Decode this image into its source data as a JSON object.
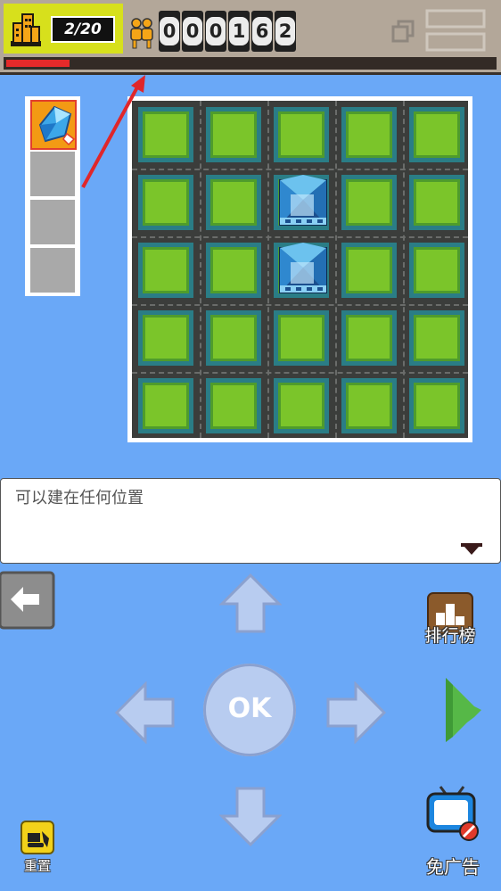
{
  "hud": {
    "buildings_count": "2/20",
    "score_digits": [
      "0",
      "0",
      "0",
      "1",
      "6",
      "2"
    ],
    "progress_fraction": 0.13
  },
  "inventory": {
    "selected_item_icon": "blue-crystal-block-icon",
    "empty_slots": 3
  },
  "grid": {
    "rows": 5,
    "cols": 5,
    "towers": [
      {
        "row": 1,
        "col": 2
      },
      {
        "row": 2,
        "col": 2
      }
    ]
  },
  "message": {
    "text": "可以建在任何位置"
  },
  "controls": {
    "ok_label": "OK",
    "leaderboard_label": "排行榜",
    "reset_label": "重置",
    "no_ads_label": "免广告"
  },
  "colors": {
    "accent_yellow": "#d7e01c",
    "progress_red": "#e52a2a",
    "grass": "#7bc52a",
    "background_blue": "#6aa8f7"
  }
}
